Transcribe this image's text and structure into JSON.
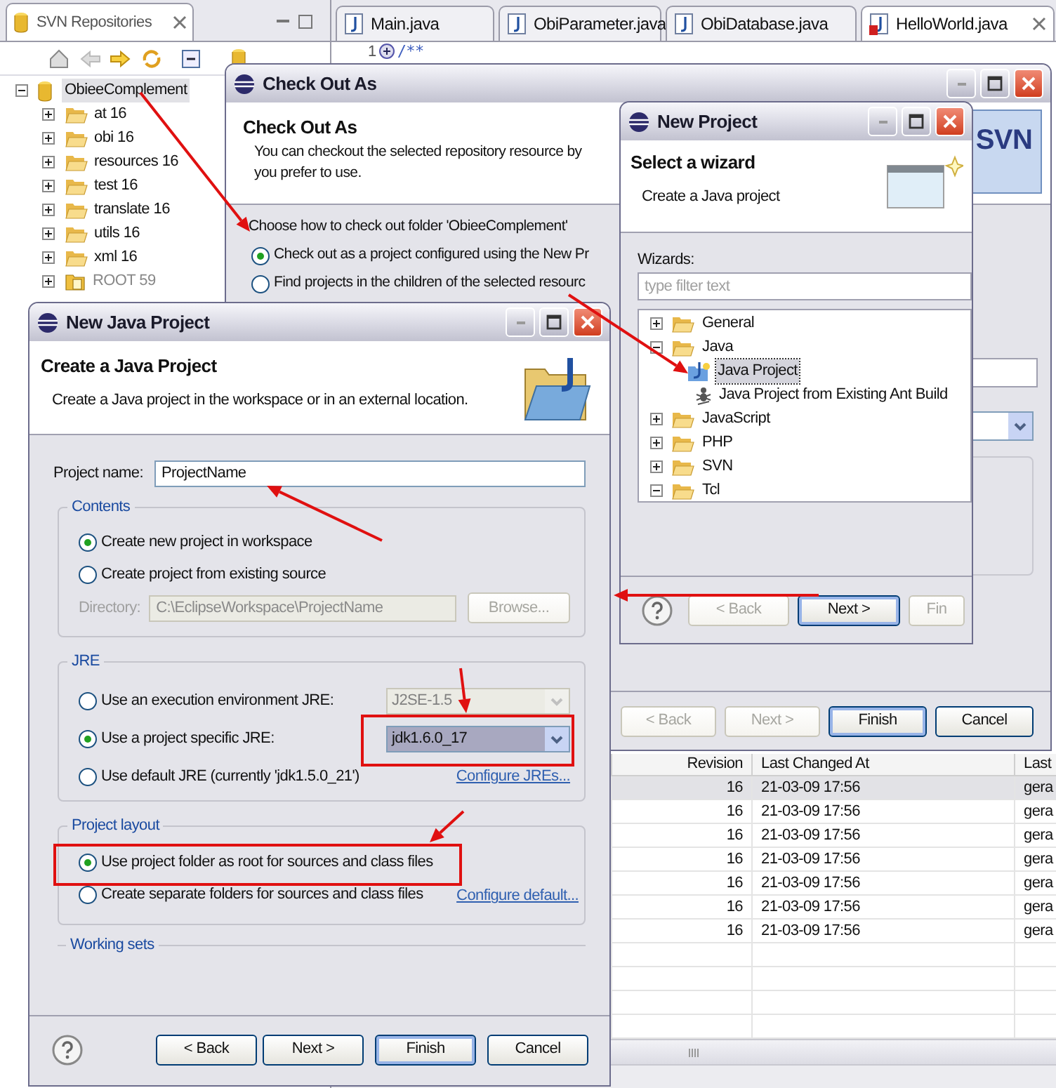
{
  "repositories_view": {
    "title": "SVN Repositories",
    "tree": [
      {
        "label": "ObieeComplement",
        "kind": "repository",
        "selected": true,
        "expanded": true,
        "children": [
          {
            "label": "at 16",
            "kind": "folder",
            "selected": false,
            "expanded": false
          },
          {
            "label": "obi 16",
            "kind": "folder",
            "selected": false,
            "expanded": false
          },
          {
            "label": "resources 16",
            "kind": "folder",
            "selected": false,
            "expanded": false
          },
          {
            "label": "test 16",
            "kind": "folder",
            "selected": false,
            "expanded": false
          },
          {
            "label": "translate 16",
            "kind": "folder",
            "selected": false,
            "expanded": false
          },
          {
            "label": "utils 16",
            "kind": "folder",
            "selected": false,
            "expanded": false
          },
          {
            "label": "xml 16",
            "kind": "folder",
            "selected": false,
            "expanded": false
          },
          {
            "label": "ROOT 59",
            "kind": "root",
            "selected": false,
            "expanded": false
          }
        ]
      }
    ]
  },
  "editor": {
    "tabs": [
      {
        "label": "Main.java",
        "selected": false,
        "error": false
      },
      {
        "label": "ObiParameter.java",
        "selected": false,
        "error": false
      },
      {
        "label": "ObiDatabase.java",
        "selected": false,
        "error": false
      },
      {
        "label": "HelloWorld.java",
        "selected": true,
        "error": true
      }
    ],
    "line_number": "1",
    "code": "/**"
  },
  "history_table": {
    "columns": [
      "Revision",
      "Last Changed At",
      "Last"
    ],
    "rows": [
      {
        "revision": "16",
        "changed": "21-03-09 17:56",
        "author": "gera",
        "selected": true
      },
      {
        "revision": "16",
        "changed": "21-03-09 17:56",
        "author": "gera",
        "selected": false
      },
      {
        "revision": "16",
        "changed": "21-03-09 17:56",
        "author": "gera",
        "selected": false
      },
      {
        "revision": "16",
        "changed": "21-03-09 17:56",
        "author": "gera",
        "selected": false
      },
      {
        "revision": "16",
        "changed": "21-03-09 17:56",
        "author": "gera",
        "selected": false
      },
      {
        "revision": "16",
        "changed": "21-03-09 17:56",
        "author": "gera",
        "selected": false
      },
      {
        "revision": "16",
        "changed": "21-03-09 17:56",
        "author": "gera",
        "selected": false
      }
    ]
  },
  "check_out_dialog": {
    "title": "Check Out As",
    "heading": "Check Out As",
    "description": [
      "You can checkout the selected repository resource by",
      "you prefer to use."
    ],
    "logo_text": "SVN",
    "prompt": "Choose how to check out folder 'ObieeComplement'",
    "options": [
      {
        "label": "Check out as a project configured using the New Pr",
        "selected": true
      },
      {
        "label": "Find projects in the children of the selected resourc",
        "selected": false
      }
    ],
    "buttons": [
      {
        "label": "< Back",
        "disabled": true,
        "default": false
      },
      {
        "label": "Next >",
        "disabled": true,
        "default": false
      },
      {
        "label": "Finish",
        "disabled": false,
        "default": true
      },
      {
        "label": "Cancel",
        "disabled": false,
        "default": false
      }
    ]
  },
  "new_project_dialog": {
    "title": "New Project",
    "heading": "Select a wizard",
    "description": "Create a Java project",
    "wizards_label": "Wizards:",
    "filter": {
      "placeholder": "type filter text"
    },
    "tree": [
      {
        "label": "General",
        "kind": "category",
        "expanded": false,
        "selected": false
      },
      {
        "label": "Java",
        "kind": "category",
        "expanded": true,
        "selected": false,
        "children": [
          {
            "label": "Java Project",
            "kind": "wizard",
            "selected": true
          },
          {
            "label": "Java Project from Existing Ant Build",
            "kind": "ant",
            "selected": false
          }
        ]
      },
      {
        "label": "JavaScript",
        "kind": "category",
        "expanded": false,
        "selected": false
      },
      {
        "label": "PHP",
        "kind": "category",
        "expanded": false,
        "selected": false
      },
      {
        "label": "SVN",
        "kind": "category",
        "expanded": false,
        "selected": false
      },
      {
        "label": "Tcl",
        "kind": "category",
        "expanded": true,
        "selected": false
      }
    ],
    "buttons": [
      {
        "label": "< Back",
        "disabled": true,
        "default": false
      },
      {
        "label": "Next >",
        "disabled": false,
        "default": true
      },
      {
        "label": "Fin",
        "disabled": true,
        "default": false
      }
    ]
  },
  "new_java_project_dialog": {
    "title": "New Java Project",
    "heading": "Create a Java Project",
    "description": "Create a Java project in the workspace or in an external location.",
    "project_name": {
      "label": "Project name:",
      "value": "ProjectName"
    },
    "contents": {
      "legend": "Contents",
      "options": [
        {
          "label": "Create new project in workspace",
          "selected": true
        },
        {
          "label": "Create project from existing source",
          "selected": false
        }
      ],
      "directory": {
        "label": "Directory:",
        "value": "C:\\EclipseWorkspace\\ProjectName",
        "disabled": true
      },
      "browse": {
        "label": "Browse...",
        "disabled": true
      }
    },
    "jre": {
      "legend": "JRE",
      "options": [
        {
          "label": "Use an execution environment JRE:",
          "selected": false,
          "kind": "combo",
          "value": "J2SE-1.5",
          "disabled": true
        },
        {
          "label": "Use a project specific JRE:",
          "selected": true,
          "kind": "combo",
          "value": "jdk1.6.0_17",
          "disabled": false
        },
        {
          "label": "Use default JRE (currently 'jdk1.5.0_21')",
          "selected": false,
          "kind": "link",
          "link": "Configure JREs..."
        }
      ]
    },
    "layout": {
      "legend": "Project layout",
      "options": [
        {
          "label": "Use project folder as root for sources and class files",
          "selected": true
        },
        {
          "label": "Create separate folders for sources and class files",
          "selected": false
        }
      ],
      "link": "Configure default..."
    },
    "working_sets": {
      "legend": "Working sets"
    },
    "buttons": [
      {
        "label": "< Back",
        "disabled": false,
        "default": false
      },
      {
        "label": "Next >",
        "disabled": false,
        "default": false
      },
      {
        "label": "Finish",
        "disabled": false,
        "default": true
      },
      {
        "label": "Cancel",
        "disabled": false,
        "default": false
      }
    ]
  }
}
